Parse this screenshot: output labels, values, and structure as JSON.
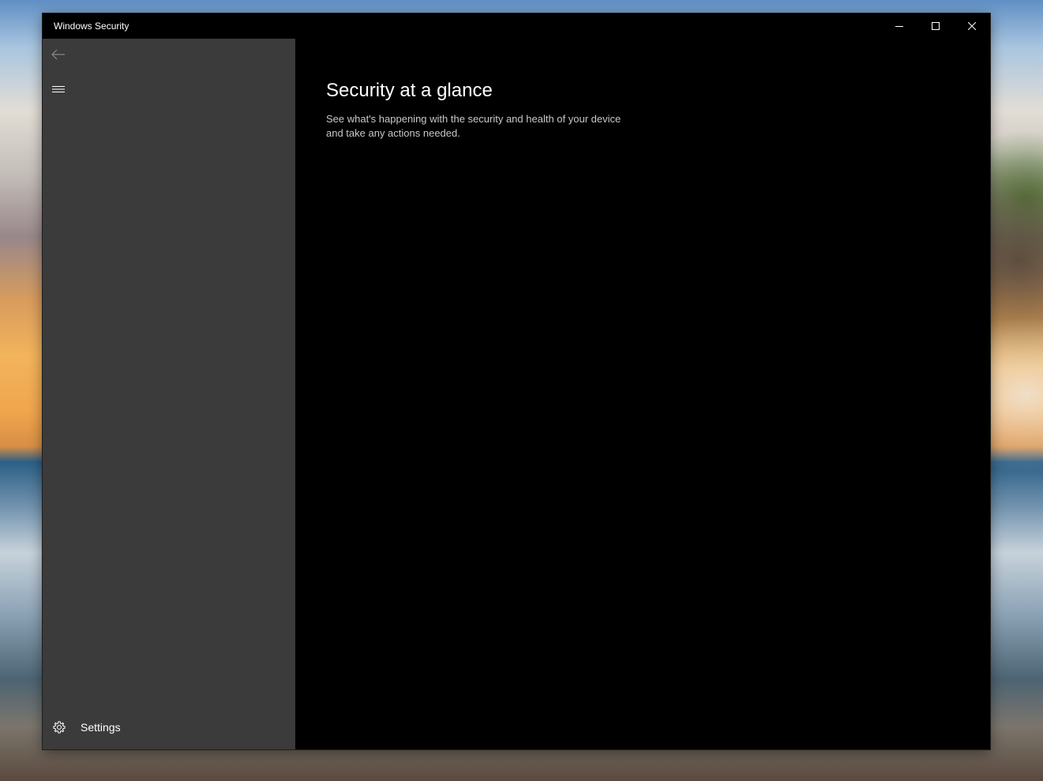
{
  "window": {
    "title": "Windows Security"
  },
  "caption_buttons": {
    "minimize_icon": "minimize-icon",
    "maximize_icon": "maximize-icon",
    "close_icon": "close-icon"
  },
  "sidebar": {
    "back_icon": "back-arrow-icon",
    "menu_icon": "hamburger-menu-icon",
    "settings": {
      "icon": "gear-icon",
      "label": "Settings"
    }
  },
  "main": {
    "title": "Security at a glance",
    "subtitle": "See what's happening with the security and health of your device and take any actions needed."
  },
  "colors": {
    "sidebar_bg": "#3b3b3b",
    "content_bg": "#000000",
    "text_primary": "#ffffff",
    "text_secondary": "#c8c8c8",
    "icon_disabled": "#8a8a8a"
  }
}
